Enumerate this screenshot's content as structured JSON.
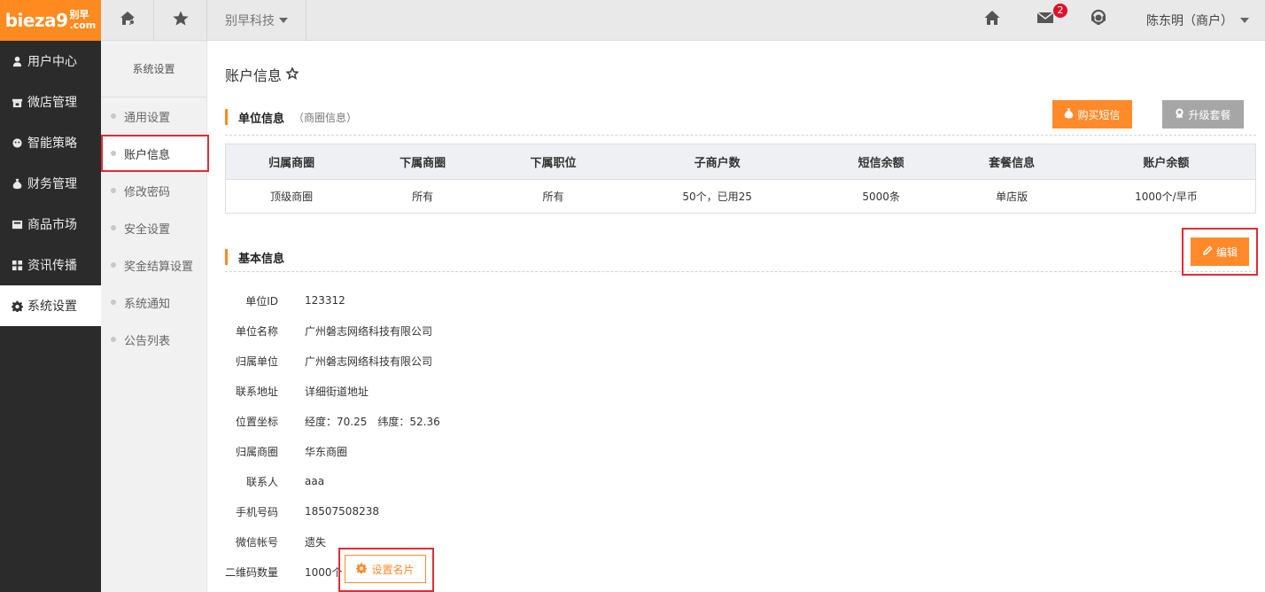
{
  "brand": {
    "logo_text": "biez",
    "logo_num": "a9",
    "logo_cn": "别早",
    "logo_dom": ".com",
    "accent": "#ff8a1f"
  },
  "topbar": {
    "company": "别早科技",
    "mail_badge": "2",
    "user": "陈东明（商户）"
  },
  "sidebar": {
    "items": [
      {
        "label": "用户中心",
        "icon": "user-icon"
      },
      {
        "label": "微店管理",
        "icon": "shop-icon"
      },
      {
        "label": "智能策略",
        "icon": "strategy-icon"
      },
      {
        "label": "财务管理",
        "icon": "money-bag-icon"
      },
      {
        "label": "商品市场",
        "icon": "market-icon"
      },
      {
        "label": "资讯传播",
        "icon": "grid-icon"
      },
      {
        "label": "系统设置",
        "icon": "gear-icon"
      }
    ]
  },
  "subnav": {
    "title": "系统设置",
    "items": [
      "通用设置",
      "账户信息",
      "修改密码",
      "安全设置",
      "奖金结算设置",
      "系统通知",
      "公告列表"
    ]
  },
  "main": {
    "title": "账户信息",
    "unit_section": {
      "title": "单位信息",
      "note": "（商圈信息）"
    },
    "buy_sms": "购买短信",
    "upgrade": "升级套餐",
    "table": {
      "headers": [
        "归属商圈",
        "下属商圈",
        "下属职位",
        "子商户数",
        "短信余额",
        "套餐信息",
        "账户余额"
      ],
      "row": [
        "顶级商圈",
        "所有",
        "所有",
        "50个，已用25",
        "5000条",
        "单店版",
        "1000个/早币"
      ]
    },
    "basic_section": {
      "title": "基本信息"
    },
    "edit": "编辑",
    "fields": [
      {
        "label": "单位ID",
        "value": "123312"
      },
      {
        "label": "单位名称",
        "value": "广州磐志网络科技有限公司"
      },
      {
        "label": "归属单位",
        "value": "广州磐志网络科技有限公司"
      },
      {
        "label": "联系地址",
        "value": "详细街道地址"
      },
      {
        "label": "位置坐标",
        "value": "经度：70.25　纬度：52.36"
      },
      {
        "label": "归属商圈",
        "value": "华东商圈"
      },
      {
        "label": "联系人",
        "value": "aaa"
      },
      {
        "label": "手机号码",
        "value": "18507508238"
      },
      {
        "label": "微信帐号",
        "value": "遗失"
      },
      {
        "label": "二维码数量",
        "value": "1000个"
      }
    ],
    "card_button": "设置名片"
  }
}
